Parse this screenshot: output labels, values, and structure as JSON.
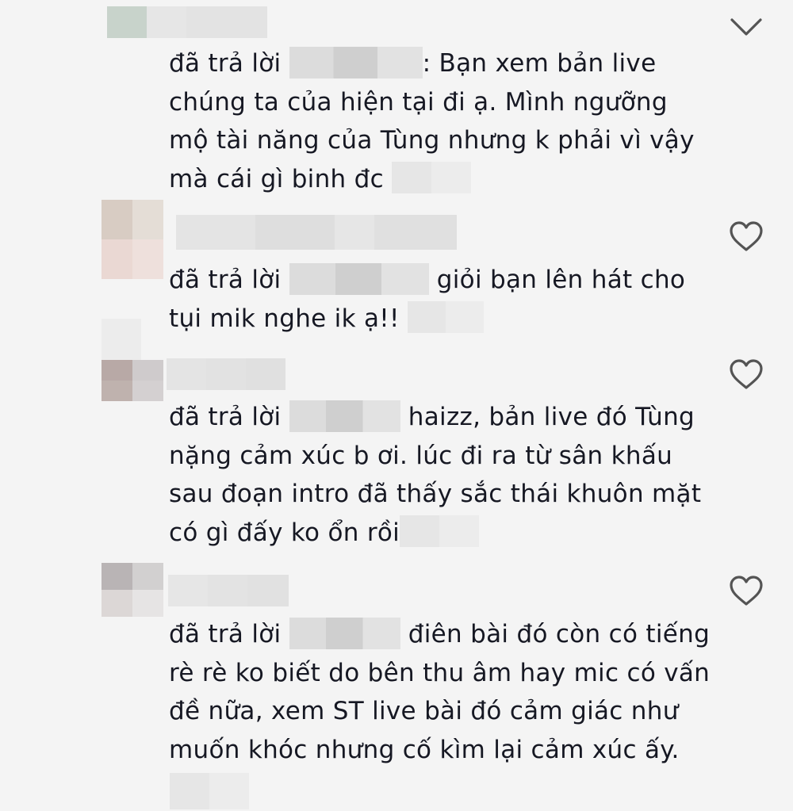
{
  "comments": [
    {
      "prefix": "đã trả lời",
      "lines": [
        ": Bạn xem bản live",
        "chúng ta của hiện tại đi ạ. Mình ngưỡng",
        "mộ tài năng của Tùng nhưng k phải vì vậy",
        "mà cái gì binh đc"
      ],
      "action_icon": "chevron-down-icon"
    },
    {
      "prefix": "đã trả lời",
      "lines": [
        "giỏi bạn lên hát cho",
        "tụi mik nghe ik ạ!!"
      ],
      "action_icon": "heart-outline-icon"
    },
    {
      "prefix": "đã trả lời",
      "lines": [
        "haizz, bản live đó Tùng",
        "nặng cảm xúc b ơi. lúc đi ra từ sân khấu",
        "sau đoạn intro đã thấy sắc thái khuôn mặt",
        "có gì đấy ko ổn rồi"
      ],
      "action_icon": "heart-outline-icon"
    },
    {
      "prefix": "đã trả lời",
      "lines": [
        "điên bài đó còn có tiếng",
        "rè rè ko biết do bên thu âm hay mic có vấn",
        "đề nữa, xem ST live bài đó cảm giác như",
        "muốn khóc nhưng cố kìm lại cảm xúc ấy."
      ],
      "action_icon": "heart-outline-icon"
    }
  ],
  "colors": {
    "background": "#f4f4f4",
    "text": "#161823",
    "icon": "#545454",
    "censor": "#d6d6d6"
  }
}
